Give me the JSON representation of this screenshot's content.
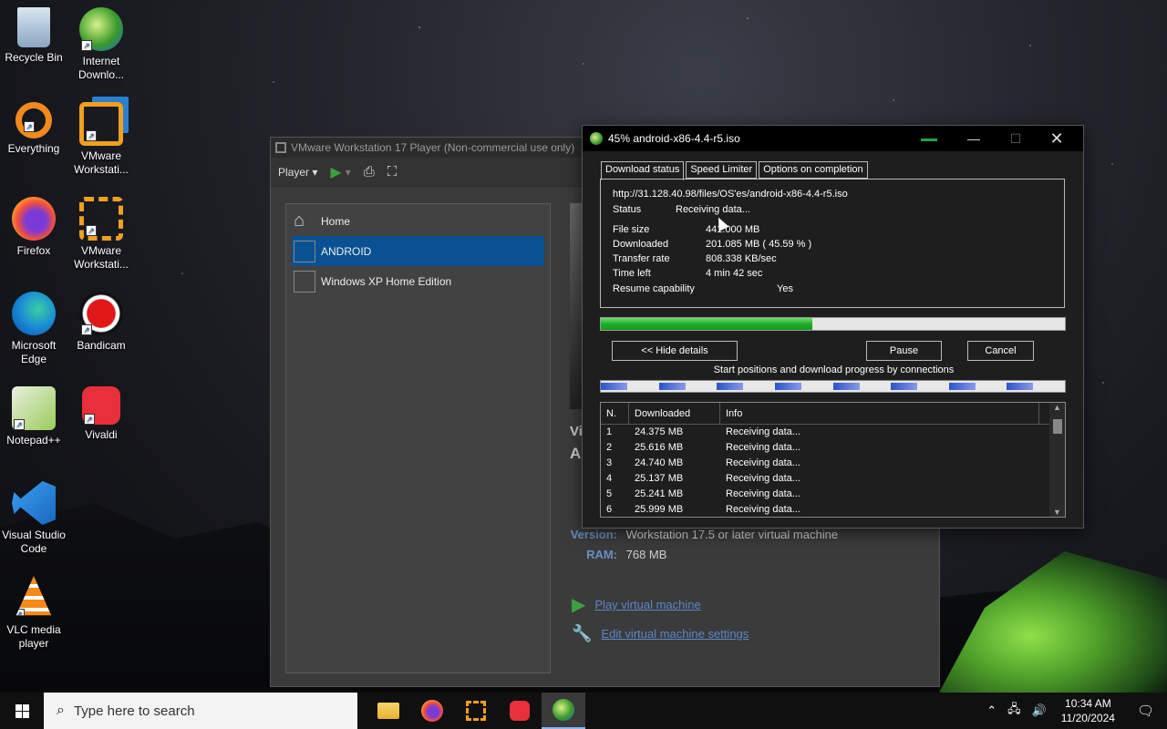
{
  "desktop": {
    "icons": [
      {
        "label": "Recycle Bin",
        "icon": "recycle-bin-icon"
      },
      {
        "label": "Internet Downlo...",
        "icon": "idm-icon"
      },
      {
        "label": "Everything",
        "icon": "everything-search-icon"
      },
      {
        "label": "VMware Workstati...",
        "icon": "vmware-icon"
      },
      {
        "label": "Firefox",
        "icon": "firefox-icon"
      },
      {
        "label": "VMware Workstati...",
        "icon": "vmware-player-icon"
      },
      {
        "label": "Microsoft Edge",
        "icon": "edge-icon"
      },
      {
        "label": "Bandicam",
        "icon": "bandicam-icon"
      },
      {
        "label": "Notepad++",
        "icon": "notepadpp-icon"
      },
      {
        "label": "Vivaldi",
        "icon": "vivaldi-icon"
      },
      {
        "label": "Visual Studio Code",
        "icon": "vscode-icon"
      },
      {
        "label": "VLC media player",
        "icon": "vlc-icon"
      }
    ]
  },
  "vmware": {
    "title": "VMware Workstation 17 Player (Non-commercial use only)",
    "menu_player": "Player",
    "library": [
      {
        "label": "Home"
      },
      {
        "label": "ANDROID"
      },
      {
        "label": "Windows XP Home Edition"
      }
    ],
    "vm_name_short": "Vi",
    "vm_sub_short": "A",
    "version_label": "Version:",
    "version_value": "Workstation 17.5 or later virtual machine",
    "ram_label": "RAM:",
    "ram_value": "768 MB",
    "play_label": "Play virtual machine",
    "edit_label": "Edit virtual machine settings"
  },
  "idm": {
    "title": "45% android-x86-4.4-r5.iso",
    "tabs": [
      "Download status",
      "Speed Limiter",
      "Options on completion"
    ],
    "url": "http://31.128.40.98/files/OS'es/android-x86-4.4-r5.iso",
    "status_label": "Status",
    "status_value": "Receiving data...",
    "file_size_label": "File size",
    "file_size_value": "441.000  MB",
    "downloaded_label": "Downloaded",
    "downloaded_value": "201.085  MB  ( 45.59 % )",
    "transfer_label": "Transfer rate",
    "transfer_value": "808.338  KB/sec",
    "time_left_label": "Time left",
    "time_left_value": "4 min 42 sec",
    "resume_label": "Resume capability",
    "resume_value": "Yes",
    "progress": 0.4559,
    "hide_details": "<< Hide details",
    "pause": "Pause",
    "cancel": "Cancel",
    "connections_label": "Start positions and download progress by connections",
    "columns": [
      "N.",
      "Downloaded",
      "Info"
    ],
    "connections": [
      {
        "n": "1",
        "downloaded": "24.375  MB",
        "info": "Receiving data..."
      },
      {
        "n": "2",
        "downloaded": "25.616  MB",
        "info": "Receiving data..."
      },
      {
        "n": "3",
        "downloaded": "24.740  MB",
        "info": "Receiving data..."
      },
      {
        "n": "4",
        "downloaded": "25.137  MB",
        "info": "Receiving data..."
      },
      {
        "n": "5",
        "downloaded": "25.241  MB",
        "info": "Receiving data..."
      },
      {
        "n": "6",
        "downloaded": "25.999  MB",
        "info": "Receiving data..."
      }
    ]
  },
  "taskbar": {
    "search_placeholder": "Type here to search",
    "time": "10:34 AM",
    "date": "11/20/2024"
  }
}
